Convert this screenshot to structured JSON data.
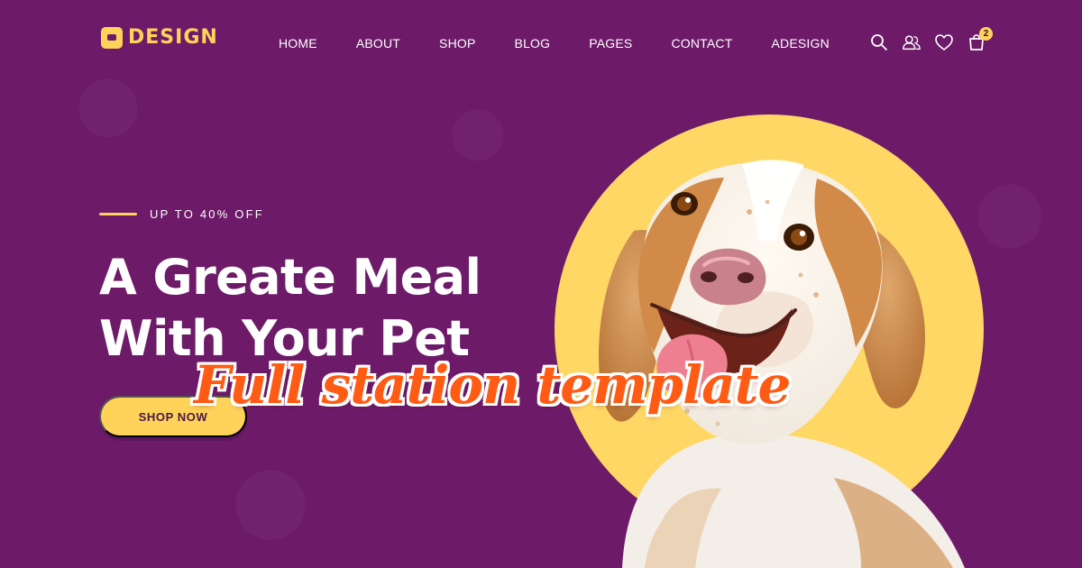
{
  "brand": {
    "logo_text": "Design"
  },
  "nav": {
    "items": [
      "HOME",
      "ABOUT",
      "SHOP",
      "BLOG",
      "PAGES",
      "CONTACT",
      "ADESIGN"
    ]
  },
  "header_icons": {
    "search": "search-icon",
    "account": "user-icon",
    "wishlist": "heart-icon",
    "cart": "cart-icon",
    "cart_count": "2"
  },
  "hero": {
    "eyebrow": "UP TO 40% OFF",
    "title_line_1": "A Greate Meal",
    "title_line_2": "With Your Pet",
    "button_label": "SHOP NOW"
  },
  "overlay": {
    "text": "Full station template"
  },
  "colors": {
    "background": "#6d1b68",
    "accent": "#ffd35a",
    "overlay": "#ff5b14"
  }
}
